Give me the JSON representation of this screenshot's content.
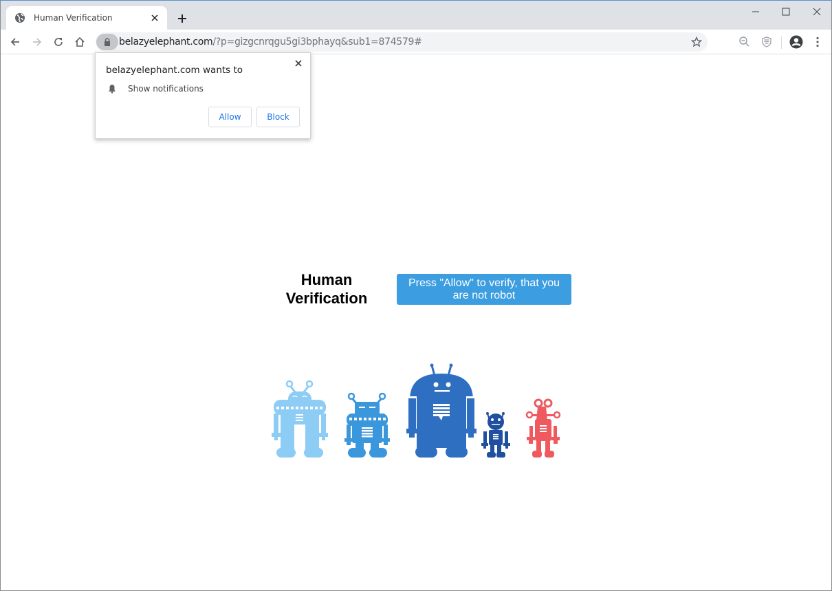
{
  "browser": {
    "tab": {
      "title": "Human Verification",
      "favicon": "globe-icon"
    },
    "url": {
      "host": "belazyelephant.com",
      "path": "/?p=gizgcnrqgu5gi3bphayq&sub1=874579#"
    },
    "toolbar_icons": [
      "back-icon",
      "forward-icon",
      "reload-icon",
      "home-icon",
      "lock-icon",
      "star-icon",
      "zoom-out-icon",
      "shield-extension-icon",
      "profile-icon",
      "menu-icon"
    ],
    "window_controls": [
      "minimize-icon",
      "maximize-icon",
      "close-icon"
    ]
  },
  "permission_popup": {
    "title": "belazyelephant.com wants to",
    "permission": "Show notifications",
    "permission_icon": "bell-icon",
    "allow_label": "Allow",
    "block_label": "Block"
  },
  "page": {
    "heading_line1": "Human",
    "heading_line2": "Verification",
    "verify_button": "Press \"Allow\" to verify, that you are not robot",
    "robots": [
      {
        "name": "robot-light-blue",
        "color": "#8dcdf5"
      },
      {
        "name": "robot-medium-blue",
        "color": "#3b97dc"
      },
      {
        "name": "robot-large-blue",
        "color": "#2f6fc2"
      },
      {
        "name": "robot-small-navy",
        "color": "#1f4fa0"
      },
      {
        "name": "robot-red",
        "color": "#ee5a5e"
      }
    ]
  },
  "colors": {
    "accent_button": "#3c9de0",
    "link_blue": "#1a73e8"
  }
}
